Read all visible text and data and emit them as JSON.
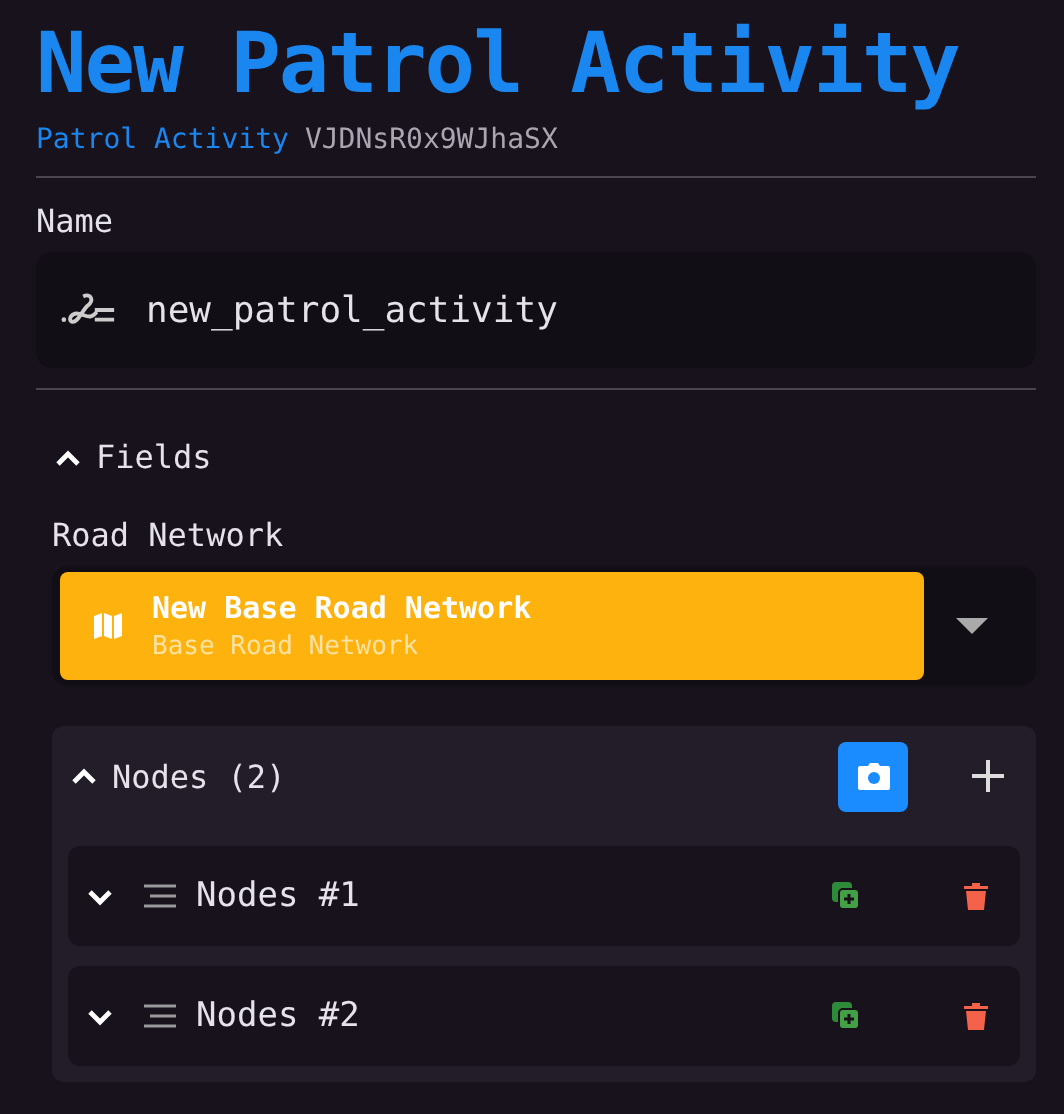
{
  "header": {
    "title": "New Patrol Activity",
    "type_label": "Patrol Activity",
    "id": "VJDNsR0x9WJhaSX"
  },
  "name_field": {
    "label": "Name",
    "value": "new_patrol_activity"
  },
  "fields_section": {
    "title": "Fields",
    "expanded": true,
    "road_network": {
      "label": "Road Network",
      "selected_title": "New Base Road Network",
      "selected_subtitle": "Base Road Network"
    },
    "nodes": {
      "title": "Nodes (2)",
      "expanded": true,
      "items": [
        {
          "title": "Nodes #1",
          "expanded": false
        },
        {
          "title": "Nodes #2",
          "expanded": false
        }
      ]
    }
  }
}
